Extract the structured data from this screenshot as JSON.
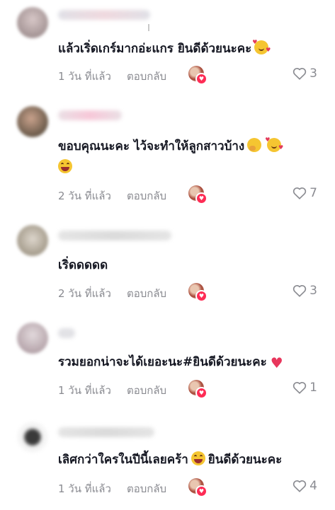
{
  "comments": [
    {
      "text": "แล้วเริ่ดเกร์มากอ่ะแกร ยินดีด้วยนะคะ",
      "emoji_after": "smiling-face-with-hearts",
      "time": "1 วัน ที่แล้ว",
      "reply": "ตอบกลับ",
      "likes": "3"
    },
    {
      "text": "ขอบคุณนะคะ ไว้จะทำให้ลูกสาวบ้าง",
      "emoji_after": "face-with-hand-over-mouth, smiling-face-with-hearts, face-with-tears-of-joy",
      "time": "2 วัน ที่แล้ว",
      "reply": "ตอบกลับ",
      "likes": "7"
    },
    {
      "text": "เริ่ดดดดด",
      "time": "2 วัน ที่แล้ว",
      "reply": "ตอบกลับ",
      "likes": "3"
    },
    {
      "text": "รวมยอกน่าจะได้เยอะนะ#ยินดีด้วยนะคะ",
      "emoji_after": "red-heart",
      "time": "1 วัน ที่แล้ว",
      "reply": "ตอบกลับ",
      "likes": "1"
    },
    {
      "text_before": "เลิศกว่าใครในปีนี้เลยคร้า",
      "emoji_mid": "face-with-tears-of-joy",
      "text_after": "ยินดีด้วยนะคะ",
      "time": "1 วัน ที่แล้ว",
      "reply": "ตอบกลับ",
      "likes": "4"
    }
  ],
  "colors": {
    "text": "#161823",
    "meta": "#8a8b91",
    "badge": "#fe2c55"
  }
}
